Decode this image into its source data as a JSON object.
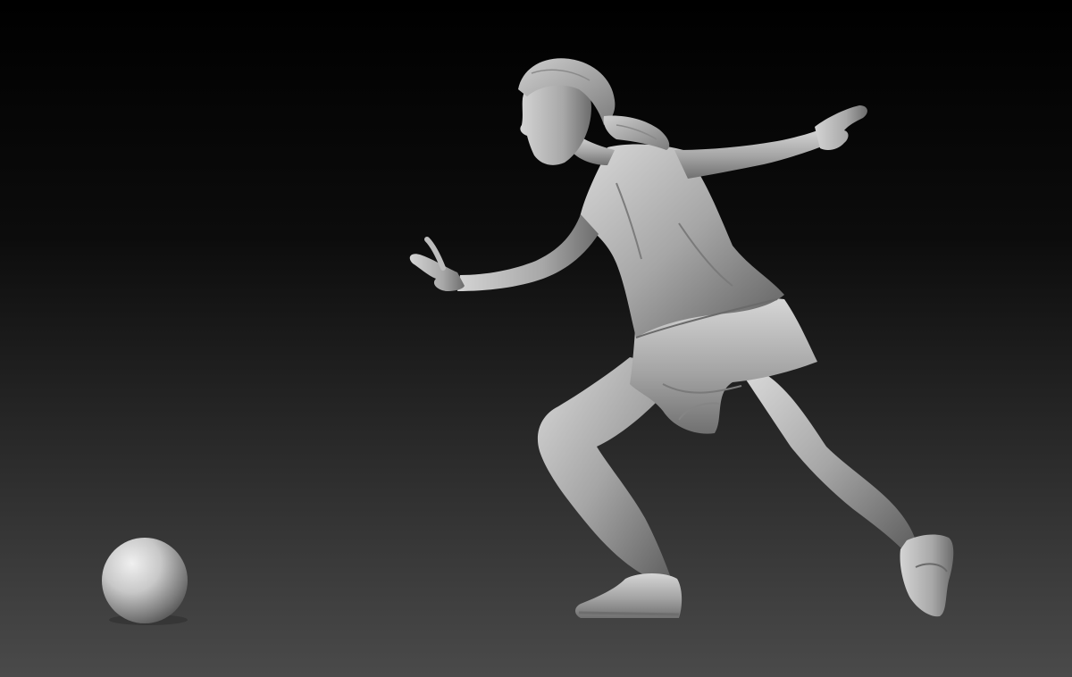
{
  "scene": {
    "description_label": "",
    "background": {
      "top": "#000000",
      "bottom": "#4a4a4a"
    },
    "material": {
      "base": "#9a9a9a",
      "light": "#dadada",
      "dark": "#4e4e4e"
    },
    "objects": [
      "bowling-ball",
      "female-bowler-sculpt"
    ]
  }
}
